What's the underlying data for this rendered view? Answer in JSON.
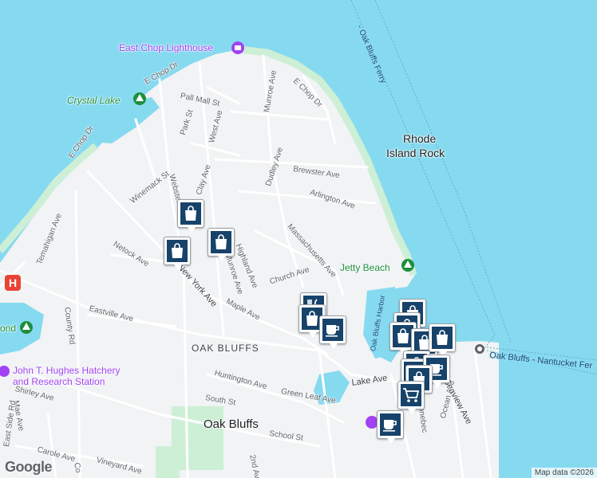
{
  "colors": {
    "water": "#86daf0",
    "land": "#f1f3f4",
    "park": "#cdefd6",
    "road": "#ffffff",
    "pin_fill": "#17436b"
  },
  "places": {
    "east_chop_lighthouse": "East Chop Lighthouse",
    "crystal_lake": "Crystal Lake",
    "rhode_island_rock_1": "Rhode",
    "rhode_island_rock_2": "Island Rock",
    "jetty_beach": "Jetty Beach",
    "hatchery_1": "John T. Hughes Hatchery",
    "hatchery_2": "and Research Station",
    "oak_bluffs_area": "OAK BLUFFS",
    "oak_bluffs_town": "Oak Bluffs",
    "pond": "ond"
  },
  "water_labels": {
    "ferry_top": "- Oak Bluffs Ferry",
    "ferry_nantucket": "Oak Bluffs - Nantucket Fer",
    "harbor": "Oak Bluffs Harbor"
  },
  "streets": {
    "e_chop_dr_1": "E Chop Dr",
    "e_chop_dr_2": "E Chop Dr",
    "e_chop_dr_3": "E Chop Dr",
    "munroe_ave_top": "Munroe Ave",
    "pall_mall_st": "Pall Mall St",
    "park_st": "Park St",
    "west_ave": "West Ave",
    "dudley_ave": "Dudley Ave",
    "brewster_ave": "Brewster Ave",
    "arlington_ave": "Arlington Ave",
    "winemack_st": "Winemack St",
    "webster": "Webster",
    "clay_ave": "Clay Ave",
    "temahigan_ave": "Temahigan Ave",
    "massachusetts_ave": "Massachusetts Ave",
    "netock_ave": "Netock Ave",
    "new_york_ave": "New York Ave",
    "munroe_ave": "Munroe Ave",
    "highland_ave": "Highland Ave",
    "church_ave": "Church Ave",
    "maple_ave": "Maple Ave",
    "eastville_ave": "Eastville Ave",
    "county_rd": "County Rd",
    "lake_ave": "Lake Ave",
    "huntington_ave": "Huntington Ave",
    "green_leaf_ave": "Green Leaf Ave",
    "south_st": "South St",
    "shirley_ave": "Shirley Ave",
    "mae_ave": "Mae Ave",
    "school_st": "School St",
    "east_side_rd": "East Side Rd",
    "carole_ave": "Carole Ave",
    "vineyard_ave": "Vineyard Ave",
    "second_ave": "2nd Ave",
    "kennebec": "Kennebec",
    "ocean_ave": "Ocean Ave",
    "seaview_ave": "Seaview Ave",
    "co": "Co"
  },
  "pins": [
    {
      "icon": "bag"
    },
    {
      "icon": "bag"
    },
    {
      "icon": "bag"
    },
    {
      "icon": "cutlery"
    },
    {
      "icon": "bag"
    },
    {
      "icon": "coffee"
    },
    {
      "icon": "bag"
    },
    {
      "icon": "bag"
    },
    {
      "icon": "bag"
    },
    {
      "icon": "bag"
    },
    {
      "icon": "bag"
    },
    {
      "icon": "bag"
    },
    {
      "icon": "bag"
    },
    {
      "icon": "coffee"
    },
    {
      "icon": "bag"
    },
    {
      "icon": "cart"
    },
    {
      "icon": "coffee"
    }
  ],
  "footer": {
    "logo": "Google",
    "attribution": "Map data ©2026"
  }
}
